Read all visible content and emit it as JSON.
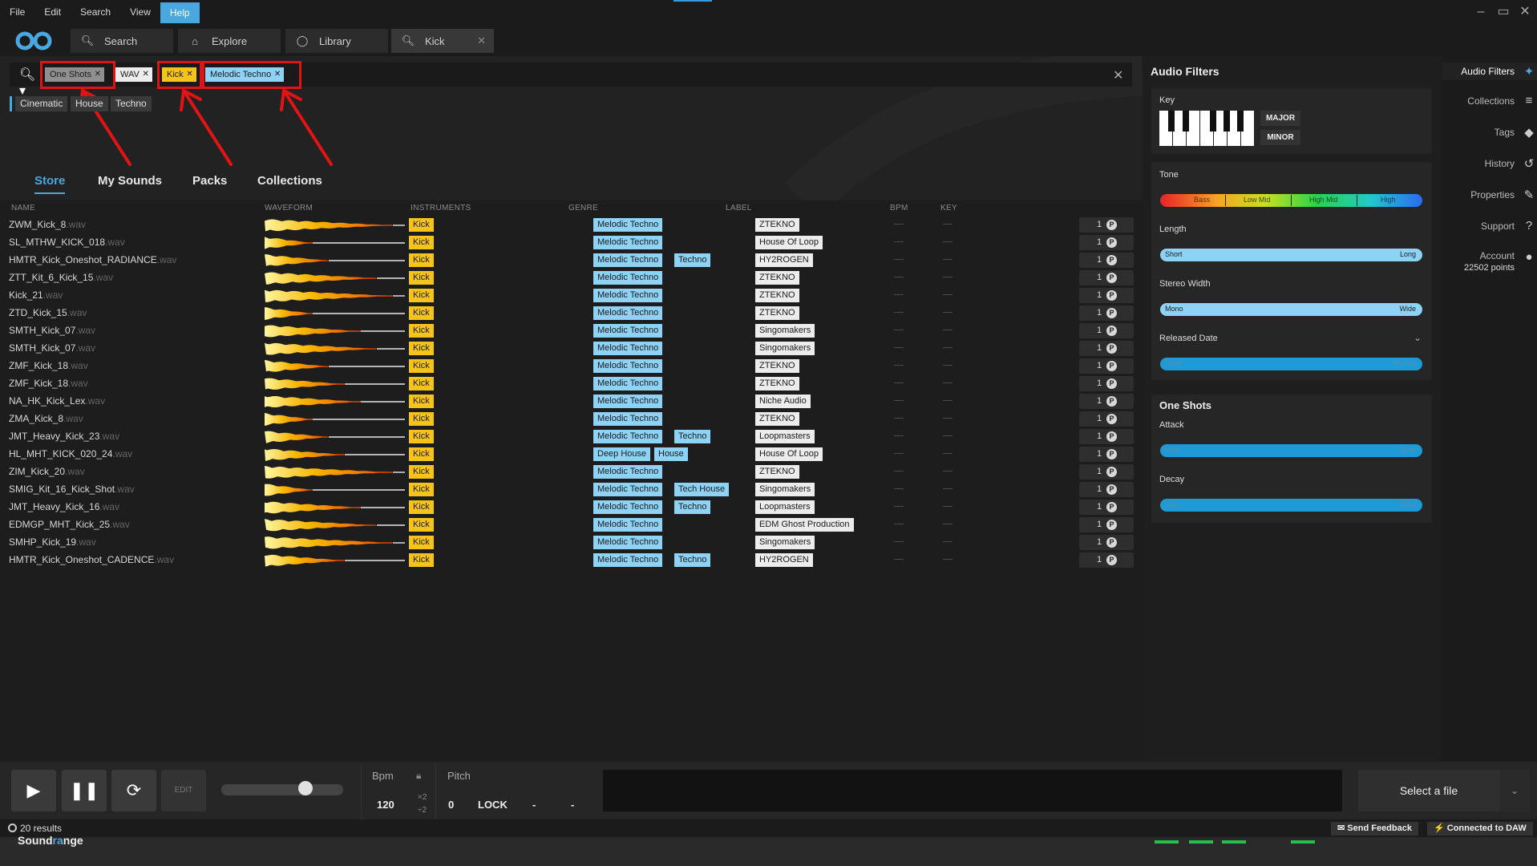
{
  "menu": {
    "items": [
      "File",
      "Edit",
      "Search",
      "View",
      "Help"
    ],
    "active": "Help"
  },
  "tabs": [
    {
      "label": "Search",
      "icon": "search-icon"
    },
    {
      "label": "Explore",
      "icon": "home-icon"
    },
    {
      "label": "Library",
      "icon": "user-icon"
    },
    {
      "label": "Kick",
      "icon": "search-icon",
      "closable": true
    }
  ],
  "search": {
    "chips": [
      {
        "label": "One Shots",
        "style": "grey"
      },
      {
        "label": "WAV",
        "style": "white"
      },
      {
        "label": "Kick",
        "style": "yellow"
      },
      {
        "label": "Melodic Techno",
        "style": "blue"
      }
    ],
    "suggestions": [
      "Cinematic",
      "House",
      "Techno"
    ]
  },
  "nav_tabs": [
    "Store",
    "My Sounds",
    "Packs",
    "Collections"
  ],
  "nav_active": "Store",
  "columns": [
    "NAME",
    "WAVEFORM",
    "INSTRUMENTS",
    "GENRE",
    "LABEL",
    "BPM",
    "KEY"
  ],
  "rows": [
    {
      "name": "ZWM_Kick_8",
      "ext": ".wav",
      "inst": "Kick",
      "genres": [
        "Melodic Techno"
      ],
      "label": "ZTEKNO",
      "count": "1"
    },
    {
      "name": "SL_MTHW_KICK_018",
      "ext": ".wav",
      "inst": "Kick",
      "genres": [
        "Melodic Techno"
      ],
      "label": "House Of Loop",
      "count": "1"
    },
    {
      "name": "HMTR_Kick_Oneshot_RADIANCE",
      "ext": ".wav",
      "inst": "Kick",
      "genres": [
        "Melodic Techno",
        "Techno"
      ],
      "label": "HY2ROGEN",
      "count": "1"
    },
    {
      "name": "ZTT_Kit_6_Kick_15",
      "ext": ".wav",
      "inst": "Kick",
      "genres": [
        "Melodic Techno"
      ],
      "label": "ZTEKNO",
      "count": "1"
    },
    {
      "name": "Kick_21",
      "ext": ".wav",
      "inst": "Kick",
      "genres": [
        "Melodic Techno"
      ],
      "label": "ZTEKNO",
      "count": "1"
    },
    {
      "name": "ZTD_Kick_15",
      "ext": ".wav",
      "inst": "Kick",
      "genres": [
        "Melodic Techno"
      ],
      "label": "ZTEKNO",
      "count": "1"
    },
    {
      "name": "SMTH_Kick_07",
      "ext": ".wav",
      "inst": "Kick",
      "genres": [
        "Melodic Techno"
      ],
      "label": "Singomakers",
      "count": "1"
    },
    {
      "name": "SMTH_Kick_07",
      "ext": ".wav",
      "inst": "Kick",
      "genres": [
        "Melodic Techno"
      ],
      "label": "Singomakers",
      "count": "1"
    },
    {
      "name": "ZMF_Kick_18",
      "ext": ".wav",
      "inst": "Kick",
      "genres": [
        "Melodic Techno"
      ],
      "label": "ZTEKNO",
      "count": "1"
    },
    {
      "name": "ZMF_Kick_18",
      "ext": ".wav",
      "inst": "Kick",
      "genres": [
        "Melodic Techno"
      ],
      "label": "ZTEKNO",
      "count": "1"
    },
    {
      "name": "NA_HK_Kick_Lex",
      "ext": ".wav",
      "inst": "Kick",
      "genres": [
        "Melodic Techno"
      ],
      "label": "Niche Audio",
      "count": "1"
    },
    {
      "name": "ZMA_Kick_8",
      "ext": ".wav",
      "inst": "Kick",
      "genres": [
        "Melodic Techno"
      ],
      "label": "ZTEKNO",
      "count": "1"
    },
    {
      "name": "JMT_Heavy_Kick_23",
      "ext": ".wav",
      "inst": "Kick",
      "genres": [
        "Melodic Techno",
        "Techno"
      ],
      "label": "Loopmasters",
      "count": "1"
    },
    {
      "name": "HL_MHT_KICK_020_24",
      "ext": ".wav",
      "inst": "Kick",
      "genres": [
        "Deep House",
        "House"
      ],
      "label": "House Of Loop",
      "count": "1"
    },
    {
      "name": "ZIM_Kick_20",
      "ext": ".wav",
      "inst": "Kick",
      "genres": [
        "Melodic Techno"
      ],
      "label": "ZTEKNO",
      "count": "1"
    },
    {
      "name": "SMIG_Kit_16_Kick_Shot",
      "ext": ".wav",
      "inst": "Kick",
      "genres": [
        "Melodic Techno",
        "Tech House"
      ],
      "label": "Singomakers",
      "count": "1"
    },
    {
      "name": "JMT_Heavy_Kick_16",
      "ext": ".wav",
      "inst": "Kick",
      "genres": [
        "Melodic Techno",
        "Techno"
      ],
      "label": "Loopmasters",
      "count": "1"
    },
    {
      "name": "EDMGP_MHT_Kick_25",
      "ext": ".wav",
      "inst": "Kick",
      "genres": [
        "Melodic Techno"
      ],
      "label": "EDM Ghost Production",
      "count": "1"
    },
    {
      "name": "SMHP_Kick_19",
      "ext": ".wav",
      "inst": "Kick",
      "genres": [
        "Melodic Techno"
      ],
      "label": "Singomakers",
      "count": "1"
    },
    {
      "name": "HMTR_Kick_Oneshot_CADENCE",
      "ext": ".wav",
      "inst": "Kick",
      "genres": [
        "Melodic Techno",
        "Techno"
      ],
      "label": "HY2ROGEN",
      "count": "1"
    }
  ],
  "filters": {
    "title": "Audio Filters",
    "key_label": "Key",
    "major": "MAJOR",
    "minor": "MINOR",
    "tone_label": "Tone",
    "tone_bands": [
      "Bass",
      "Low Mid",
      "High Mid",
      "High"
    ],
    "length_label": "Length",
    "length_range": [
      "Short",
      "Long"
    ],
    "stereo_label": "Stereo Width",
    "stereo_range": [
      "Mono",
      "Wide"
    ],
    "released_label": "Released Date",
    "released_range": [
      "Older",
      "Recent"
    ],
    "oneshots_title": "One Shots",
    "attack_label": "Attack",
    "attack_range": [
      "Fast",
      "Slow"
    ],
    "decay_label": "Decay",
    "decay_range": [
      "Fast",
      "Slow"
    ]
  },
  "sidebar": [
    {
      "label": "Audio Filters",
      "icon": "sparkle-icon"
    },
    {
      "label": "Collections",
      "icon": "list-icon"
    },
    {
      "label": "Tags",
      "icon": "tag-icon"
    },
    {
      "label": "History",
      "icon": "history-icon"
    },
    {
      "label": "Properties",
      "icon": "pencil-icon"
    },
    {
      "label": "Support",
      "icon": "help-icon"
    },
    {
      "label": "Account",
      "icon": "user-icon",
      "sub": "22502 points"
    }
  ],
  "player": {
    "edit": "EDIT",
    "bpm_label": "Bpm",
    "bpm_value": "120",
    "x2": "×2",
    "div2": "÷2",
    "pitch_label": "Pitch",
    "pitch_value": "0",
    "lock": "LOCK",
    "minus1": "-",
    "minus2": "-",
    "select_file": "Select a file"
  },
  "status": {
    "results": "20 results",
    "feedback": "Send Feedback",
    "daw": "Connected to DAW"
  },
  "brand": {
    "a": "Sound",
    "b": "ra",
    "c": "nge"
  },
  "colors": {
    "accent": "#4aa8e0",
    "instrument": "#f6c418",
    "genre": "#8ed3f5",
    "annotation": "#e01414"
  }
}
